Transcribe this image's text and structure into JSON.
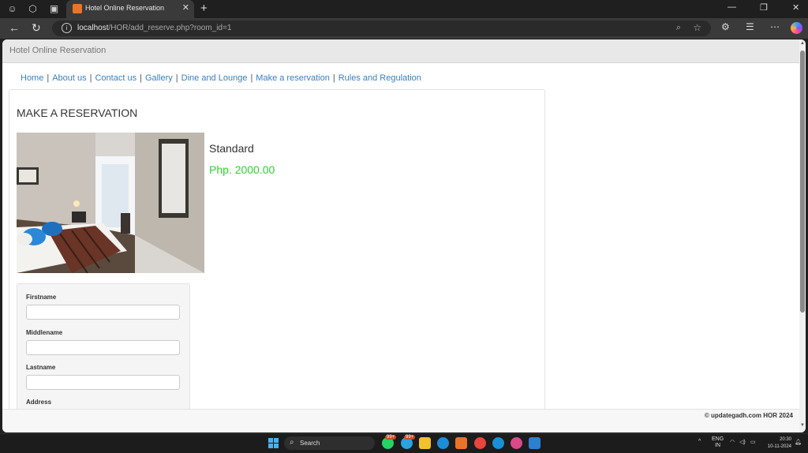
{
  "browser": {
    "tab_title": "Hotel Online Reservation",
    "url_host": "localhost",
    "url_path": "/HOR/add_reserve.php?room_id=1"
  },
  "site": {
    "brand": "Hotel Online Reservation",
    "nav": [
      {
        "label": "Home"
      },
      {
        "label": "About us"
      },
      {
        "label": "Contact us"
      },
      {
        "label": "Gallery"
      },
      {
        "label": "Dine and Lounge"
      },
      {
        "label": "Make a reservation"
      },
      {
        "label": "Rules and Regulation"
      }
    ],
    "separator": "|",
    "page_title": "MAKE A RESERVATION",
    "room": {
      "name": "Standard",
      "price": "Php. 2000.00"
    },
    "form": {
      "firstname_label": "Firstname",
      "middlename_label": "Middlename",
      "lastname_label": "Lastname",
      "address_label": "Address"
    },
    "footer": "© updategadh.com HOR 2024"
  },
  "taskbar": {
    "search_label": "Search",
    "badge1": "99+",
    "badge2": "99+",
    "lang_top": "ENG",
    "lang_bottom": "IN",
    "time": "20:30",
    "date": "10-11-2024"
  },
  "colors": {
    "link": "#3a7fc0",
    "price": "#2bd62b"
  }
}
